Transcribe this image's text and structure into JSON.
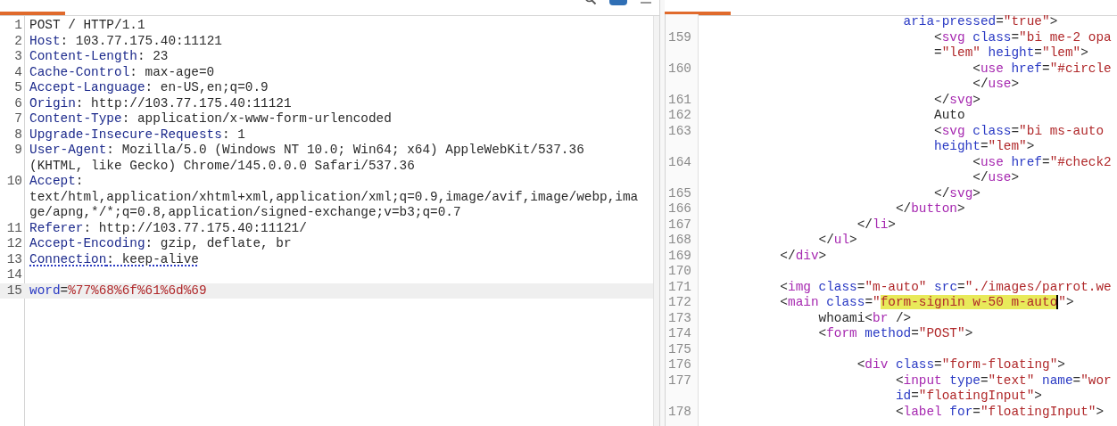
{
  "request": {
    "tabs": [
      {
        "selected": true
      },
      {
        "selected": false
      },
      {
        "selected": false
      }
    ],
    "lines": [
      {
        "number": "1",
        "current": false,
        "flagged": false,
        "rows": [
          {
            "segments": [
              {
                "kind": "plain",
                "text": "POST / HTTP/1.1"
              }
            ]
          }
        ]
      },
      {
        "number": "2",
        "current": false,
        "flagged": false,
        "rows": [
          {
            "segments": [
              {
                "kind": "key",
                "text": "Host"
              },
              {
                "kind": "plain",
                "text": ": 103.77.175.40:11121"
              }
            ]
          }
        ]
      },
      {
        "number": "3",
        "current": false,
        "flagged": false,
        "rows": [
          {
            "segments": [
              {
                "kind": "key",
                "text": "Content-Length"
              },
              {
                "kind": "plain",
                "text": ": 23"
              }
            ]
          }
        ]
      },
      {
        "number": "4",
        "current": false,
        "flagged": false,
        "rows": [
          {
            "segments": [
              {
                "kind": "key",
                "text": "Cache-Control"
              },
              {
                "kind": "plain",
                "text": ": max-age=0"
              }
            ]
          }
        ]
      },
      {
        "number": "5",
        "current": false,
        "flagged": false,
        "rows": [
          {
            "segments": [
              {
                "kind": "key",
                "text": "Accept-Language"
              },
              {
                "kind": "plain",
                "text": ": en-US,en;q=0.9"
              }
            ]
          }
        ]
      },
      {
        "number": "6",
        "current": false,
        "flagged": false,
        "rows": [
          {
            "segments": [
              {
                "kind": "key",
                "text": "Origin"
              },
              {
                "kind": "plain",
                "text": ": http://103.77.175.40:11121"
              }
            ]
          }
        ]
      },
      {
        "number": "7",
        "current": false,
        "flagged": false,
        "rows": [
          {
            "segments": [
              {
                "kind": "key",
                "text": "Content-Type"
              },
              {
                "kind": "plain",
                "text": ": application/x-www-form-urlencoded"
              }
            ]
          }
        ]
      },
      {
        "number": "8",
        "current": false,
        "flagged": false,
        "rows": [
          {
            "segments": [
              {
                "kind": "key",
                "text": "Upgrade-Insecure-Requests"
              },
              {
                "kind": "plain",
                "text": ": 1"
              }
            ]
          }
        ]
      },
      {
        "number": "9",
        "current": false,
        "flagged": false,
        "rows": [
          {
            "segments": [
              {
                "kind": "key",
                "text": "User-Agent"
              },
              {
                "kind": "plain",
                "text": ": Mozilla/5.0 (Windows NT 10.0; Win64; x64) AppleWebKit/537.36"
              }
            ]
          },
          {
            "segments": [
              {
                "kind": "plain",
                "text": "(KHTML, like Gecko) Chrome/145.0.0.0 Safari/537.36"
              }
            ]
          }
        ]
      },
      {
        "number": "10",
        "current": false,
        "flagged": false,
        "rows": [
          {
            "segments": [
              {
                "kind": "key",
                "text": "Accept"
              },
              {
                "kind": "plain",
                "text": ":"
              }
            ]
          },
          {
            "segments": [
              {
                "kind": "plain",
                "text": "text/html,application/xhtml+xml,application/xml;q=0.9,image/avif,image/webp,ima"
              }
            ]
          },
          {
            "segments": [
              {
                "kind": "plain",
                "text": "ge/apng,*/*;q=0.8,application/signed-exchange;v=b3;q=0.7"
              }
            ]
          }
        ]
      },
      {
        "number": "11",
        "current": false,
        "flagged": false,
        "rows": [
          {
            "segments": [
              {
                "kind": "key",
                "text": "Referer"
              },
              {
                "kind": "plain",
                "text": ": http://103.77.175.40:11121/"
              }
            ]
          }
        ]
      },
      {
        "number": "12",
        "current": false,
        "flagged": false,
        "rows": [
          {
            "segments": [
              {
                "kind": "key",
                "text": "Accept-Encoding"
              },
              {
                "kind": "plain",
                "text": ": gzip, deflate, br"
              }
            ]
          }
        ]
      },
      {
        "number": "13",
        "current": false,
        "flagged": true,
        "rows": [
          {
            "segments": [
              {
                "kind": "key",
                "text": "Connection"
              },
              {
                "kind": "plain",
                "text": ": keep-alive"
              }
            ]
          }
        ]
      },
      {
        "number": "14",
        "current": false
      },
      {
        "number": "15",
        "current": true,
        "flagged": false,
        "rows": [
          {
            "segments": [
              {
                "kind": "attr",
                "text": "word"
              },
              {
                "kind": "plain",
                "text": "="
              },
              {
                "kind": "value",
                "text": "%77%68%6f%61%6d%69"
              }
            ]
          }
        ]
      }
    ]
  },
  "response": {
    "tabs": [
      {
        "selected": true
      },
      {
        "selected": false
      },
      {
        "selected": false
      },
      {
        "selected": false
      }
    ],
    "lines": [
      {
        "rows": [
          {
            "segments": [
              {
                "kind": "attr",
                "text": "                          aria-pressed"
              },
              {
                "kind": "plain",
                "text": "="
              },
              {
                "kind": "string",
                "text": "\"true\""
              },
              {
                "kind": "plain",
                "text": ">"
              }
            ]
          }
        ]
      },
      {
        "number": "159",
        "rows": [
          {
            "segments": [
              {
                "kind": "plain",
                "text": "                              <"
              },
              {
                "kind": "tag",
                "text": "svg"
              },
              {
                "kind": "attr",
                "text": " class"
              },
              {
                "kind": "plain",
                "text": "="
              },
              {
                "kind": "string",
                "text": "\"bi me-2 opa"
              }
            ]
          },
          {
            "segments": [
              {
                "kind": "plain",
                "text": "                              ="
              },
              {
                "kind": "string",
                "text": "\"lem\""
              },
              {
                "kind": "attr",
                "text": " height"
              },
              {
                "kind": "plain",
                "text": "="
              },
              {
                "kind": "string",
                "text": "\"lem\""
              },
              {
                "kind": "plain",
                "text": ">"
              }
            ]
          }
        ]
      },
      {
        "number": "160",
        "rows": [
          {
            "segments": [
              {
                "kind": "plain",
                "text": "                                   <"
              },
              {
                "kind": "tag",
                "text": "use"
              },
              {
                "kind": "attr",
                "text": " href"
              },
              {
                "kind": "plain",
                "text": "="
              },
              {
                "kind": "string",
                "text": "\"#circle"
              }
            ]
          },
          {
            "segments": [
              {
                "kind": "plain",
                "text": "                                   </"
              },
              {
                "kind": "tag",
                "text": "use"
              },
              {
                "kind": "plain",
                "text": ">"
              }
            ]
          }
        ]
      },
      {
        "number": "161",
        "rows": [
          {
            "segments": [
              {
                "kind": "plain",
                "text": "                              </"
              },
              {
                "kind": "tag",
                "text": "svg"
              },
              {
                "kind": "plain",
                "text": ">"
              }
            ]
          }
        ]
      },
      {
        "number": "162",
        "rows": [
          {
            "segments": [
              {
                "kind": "plain",
                "text": "                              Auto"
              }
            ]
          }
        ]
      },
      {
        "number": "163",
        "rows": [
          {
            "segments": [
              {
                "kind": "plain",
                "text": "                              <"
              },
              {
                "kind": "tag",
                "text": "svg"
              },
              {
                "kind": "attr",
                "text": " class"
              },
              {
                "kind": "plain",
                "text": "="
              },
              {
                "kind": "string",
                "text": "\"bi ms-auto"
              }
            ]
          },
          {
            "segments": [
              {
                "kind": "attr",
                "text": "                              height"
              },
              {
                "kind": "plain",
                "text": "="
              },
              {
                "kind": "string",
                "text": "\"lem\""
              },
              {
                "kind": "plain",
                "text": ">"
              }
            ]
          }
        ]
      },
      {
        "number": "164",
        "rows": [
          {
            "segments": [
              {
                "kind": "plain",
                "text": "                                   <"
              },
              {
                "kind": "tag",
                "text": "use"
              },
              {
                "kind": "attr",
                "text": " href"
              },
              {
                "kind": "plain",
                "text": "="
              },
              {
                "kind": "string",
                "text": "\"#check2"
              }
            ]
          },
          {
            "segments": [
              {
                "kind": "plain",
                "text": "                                   </"
              },
              {
                "kind": "tag",
                "text": "use"
              },
              {
                "kind": "plain",
                "text": ">"
              }
            ]
          }
        ]
      },
      {
        "number": "165",
        "rows": [
          {
            "segments": [
              {
                "kind": "plain",
                "text": "                              </"
              },
              {
                "kind": "tag",
                "text": "svg"
              },
              {
                "kind": "plain",
                "text": ">"
              }
            ]
          }
        ]
      },
      {
        "number": "166",
        "rows": [
          {
            "segments": [
              {
                "kind": "plain",
                "text": "                         </"
              },
              {
                "kind": "tag",
                "text": "button"
              },
              {
                "kind": "plain",
                "text": ">"
              }
            ]
          }
        ]
      },
      {
        "number": "167",
        "rows": [
          {
            "segments": [
              {
                "kind": "plain",
                "text": "                    </"
              },
              {
                "kind": "tag",
                "text": "li"
              },
              {
                "kind": "plain",
                "text": ">"
              }
            ]
          }
        ]
      },
      {
        "number": "168",
        "rows": [
          {
            "segments": [
              {
                "kind": "plain",
                "text": "               </"
              },
              {
                "kind": "tag",
                "text": "ul"
              },
              {
                "kind": "plain",
                "text": ">"
              }
            ]
          }
        ]
      },
      {
        "number": "169",
        "rows": [
          {
            "segments": [
              {
                "kind": "plain",
                "text": "          </"
              },
              {
                "kind": "tag",
                "text": "div"
              },
              {
                "kind": "plain",
                "text": ">"
              }
            ]
          }
        ]
      },
      {
        "number": "170"
      },
      {
        "number": "171",
        "rows": [
          {
            "segments": [
              {
                "kind": "plain",
                "text": "          <"
              },
              {
                "kind": "tag",
                "text": "img"
              },
              {
                "kind": "attr",
                "text": " class"
              },
              {
                "kind": "plain",
                "text": "="
              },
              {
                "kind": "string",
                "text": "\"m-auto\""
              },
              {
                "kind": "attr",
                "text": " src"
              },
              {
                "kind": "plain",
                "text": "="
              },
              {
                "kind": "string",
                "text": "\"./images/parrot.we"
              }
            ]
          }
        ]
      },
      {
        "number": "172",
        "rows": [
          {
            "segments": [
              {
                "kind": "plain",
                "text": "          <"
              },
              {
                "kind": "tag",
                "text": "main"
              },
              {
                "kind": "attr",
                "text": " class"
              },
              {
                "kind": "plain",
                "text": "="
              },
              {
                "kind": "string",
                "text": "\"",
                "highlighted": false,
                "caret": false
              },
              {
                "kind": "string",
                "text": "form-signin w-50 m-auto",
                "highlighted": true,
                "caret": true
              },
              {
                "kind": "string",
                "text": "\"",
                "highlighted": false,
                "caret": false
              },
              {
                "kind": "plain",
                "text": ">"
              }
            ]
          }
        ]
      },
      {
        "number": "173",
        "rows": [
          {
            "segments": [
              {
                "kind": "plain",
                "text": "               whoami<"
              },
              {
                "kind": "tag",
                "text": "br"
              },
              {
                "kind": "plain",
                "text": " />"
              }
            ]
          }
        ]
      },
      {
        "number": "174",
        "rows": [
          {
            "segments": [
              {
                "kind": "plain",
                "text": "               <"
              },
              {
                "kind": "tag",
                "text": "form"
              },
              {
                "kind": "attr",
                "text": " method"
              },
              {
                "kind": "plain",
                "text": "="
              },
              {
                "kind": "string",
                "text": "\"POST\""
              },
              {
                "kind": "plain",
                "text": ">"
              }
            ]
          }
        ]
      },
      {
        "number": "175"
      },
      {
        "number": "176",
        "rows": [
          {
            "segments": [
              {
                "kind": "plain",
                "text": "                    <"
              },
              {
                "kind": "tag",
                "text": "div"
              },
              {
                "kind": "attr",
                "text": " class"
              },
              {
                "kind": "plain",
                "text": "="
              },
              {
                "kind": "string",
                "text": "\"form-floating\""
              },
              {
                "kind": "plain",
                "text": ">"
              }
            ]
          }
        ]
      },
      {
        "number": "177",
        "rows": [
          {
            "segments": [
              {
                "kind": "plain",
                "text": "                         <"
              },
              {
                "kind": "tag",
                "text": "input"
              },
              {
                "kind": "attr",
                "text": " type"
              },
              {
                "kind": "plain",
                "text": "="
              },
              {
                "kind": "string",
                "text": "\"text\""
              },
              {
                "kind": "attr",
                "text": " name"
              },
              {
                "kind": "plain",
                "text": "="
              },
              {
                "kind": "string",
                "text": "\"wor"
              }
            ]
          },
          {
            "segments": [
              {
                "kind": "attr",
                "text": "                         id"
              },
              {
                "kind": "plain",
                "text": "="
              },
              {
                "kind": "string",
                "text": "\"floatingInput\""
              },
              {
                "kind": "plain",
                "text": ">"
              }
            ]
          }
        ]
      },
      {
        "number": "178",
        "rows": [
          {
            "segments": [
              {
                "kind": "plain",
                "text": "                         <"
              },
              {
                "kind": "tag",
                "text": "label"
              },
              {
                "kind": "attr",
                "text": " for"
              },
              {
                "kind": "plain",
                "text": "="
              },
              {
                "kind": "string",
                "text": "\"floatingInput\""
              },
              {
                "kind": "plain",
                "text": ">"
              }
            ]
          }
        ]
      }
    ]
  }
}
